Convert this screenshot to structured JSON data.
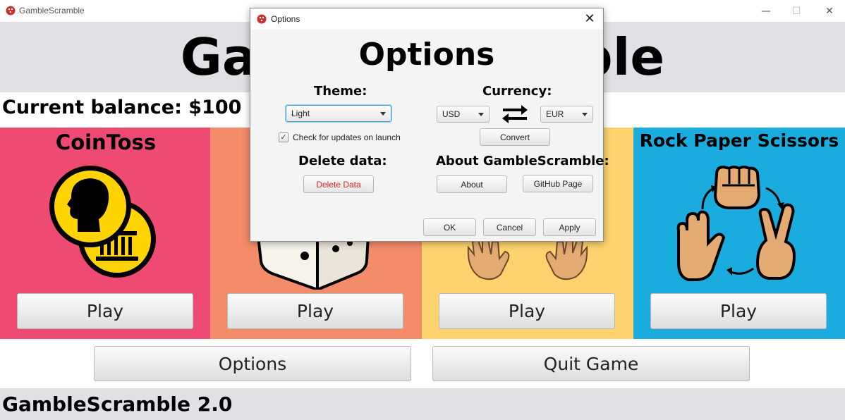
{
  "window": {
    "title": "GambleScramble",
    "big_title": "GambleScramble",
    "minimize_glyph": "—",
    "maximize_glyph": "☐",
    "close_glyph": "✕"
  },
  "balance": "Current balance: $100",
  "games": [
    {
      "title": "CoinToss",
      "play_label": "Play",
      "color": "#ee4a72",
      "icon": "coin-head-icon"
    },
    {
      "title": "",
      "play_label": "Play",
      "color": "#f48c6a",
      "icon": "dice-icon"
    },
    {
      "title": "",
      "play_label": "Play",
      "color": "#fed36e",
      "icon": "hands-icon"
    },
    {
      "title": "Rock Paper Scissors",
      "play_label": "Play",
      "color": "#1aabdf",
      "icon": "rock-paper-scissors-icon"
    }
  ],
  "bottom_buttons": {
    "options": "Options",
    "quit": "Quit Game"
  },
  "footer": "GambleScramble 2.0",
  "dialog": {
    "title": "Options",
    "heading": "Options",
    "theme_label": "Theme:",
    "theme_value": "Light",
    "check_updates_label": "Check for updates on launch",
    "check_updates_checked": "✓",
    "delete_label": "Delete data:",
    "delete_button": "Delete Data",
    "delete_color": "#e01f1f",
    "currency_label": "Currency:",
    "currency_from": "USD",
    "currency_to": "EUR",
    "convert_button": "Convert",
    "about_label": "About GambleScramble:",
    "about_button": "About",
    "github_button": "GitHub Page",
    "ok_button": "OK",
    "cancel_button": "Cancel",
    "apply_button": "Apply",
    "close_glyph": "✕"
  }
}
